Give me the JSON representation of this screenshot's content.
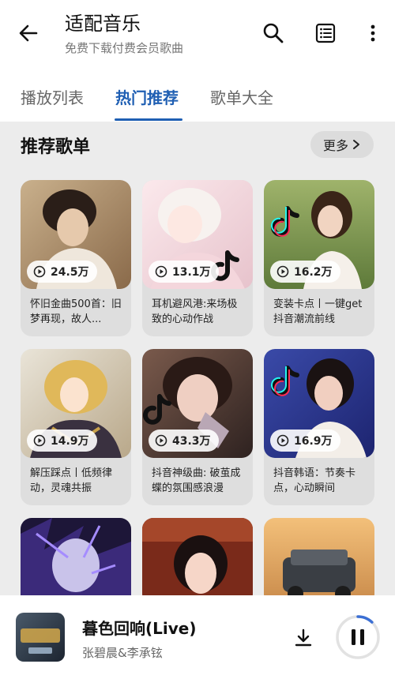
{
  "header": {
    "title": "适配音乐",
    "subtitle": "免费下载付费会员歌曲"
  },
  "tabs": [
    {
      "label": "播放列表"
    },
    {
      "label": "热门推荐"
    },
    {
      "label": "歌单大全"
    }
  ],
  "section": {
    "title": "推荐歌单",
    "more_label": "更多"
  },
  "playlists": [
    {
      "plays": "24.5万",
      "title": "怀旧金曲500首：旧梦再现，故人..."
    },
    {
      "plays": "13.1万",
      "title": "耳机避风港:来场极致的心动作战"
    },
    {
      "plays": "16.2万",
      "title": "变装卡点丨一键get抖音潮流前线"
    },
    {
      "plays": "14.9万",
      "title": "解压踩点丨低频律动，灵魂共振"
    },
    {
      "plays": "43.3万",
      "title": "抖音神级曲: 破茧成蝶的氛围感浪漫"
    },
    {
      "plays": "16.9万",
      "title": "抖音韩语：节奏卡点，心动瞬间"
    }
  ],
  "player": {
    "song": "暮色回响(Live)",
    "artist": "张碧晨&李承铉",
    "progress": 0.12
  },
  "colors": {
    "accent": "#1f5fb3",
    "progress_ring": "#3b6fd4"
  }
}
